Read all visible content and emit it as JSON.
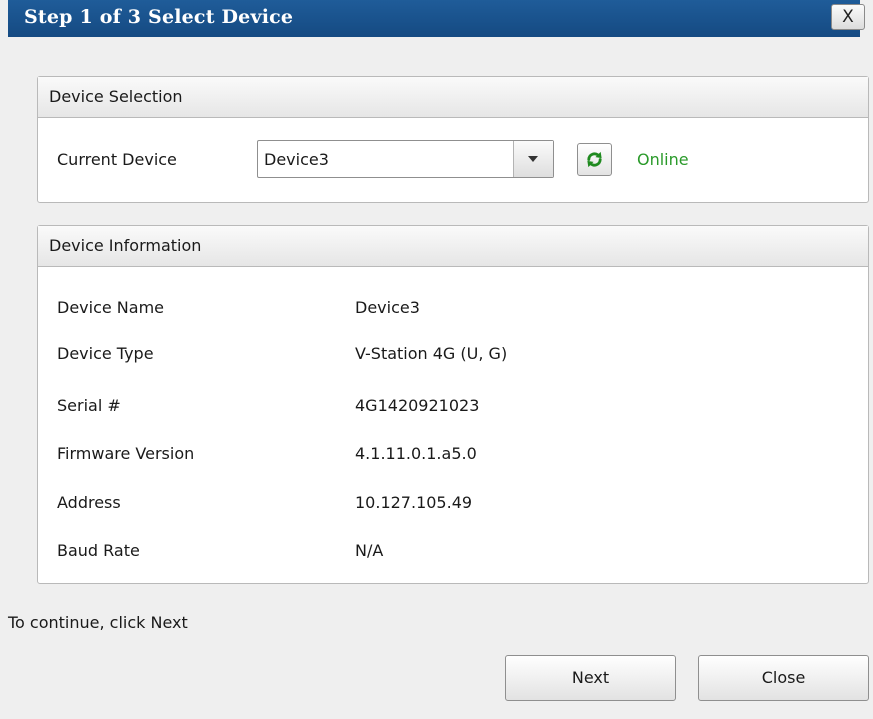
{
  "window": {
    "title": "Step 1 of 3 Select Device",
    "close_label": "X"
  },
  "device_selection": {
    "header": "Device Selection",
    "current_device_label": "Current Device",
    "current_device_value": "Device3",
    "status": "Online",
    "status_color": "#2a9a2a",
    "refresh_icon": "refresh-icon"
  },
  "device_information": {
    "header": "Device Information",
    "rows": [
      {
        "label": "Device Name",
        "value": "Device3"
      },
      {
        "label": "Device Type",
        "value": "V-Station 4G (U, G)"
      },
      {
        "label": "Serial #",
        "value": "4G1420921023"
      },
      {
        "label": "Firmware Version",
        "value": "4.1.11.0.1.a5.0"
      },
      {
        "label": "Address",
        "value": "10.127.105.49"
      },
      {
        "label": "Baud Rate",
        "value": "N/A"
      }
    ]
  },
  "footer": {
    "hint": "To continue, click Next",
    "next_label": "Next",
    "close_label": "Close"
  },
  "colors": {
    "titlebar": "#1a5490",
    "accent_green": "#2a9a2a"
  }
}
